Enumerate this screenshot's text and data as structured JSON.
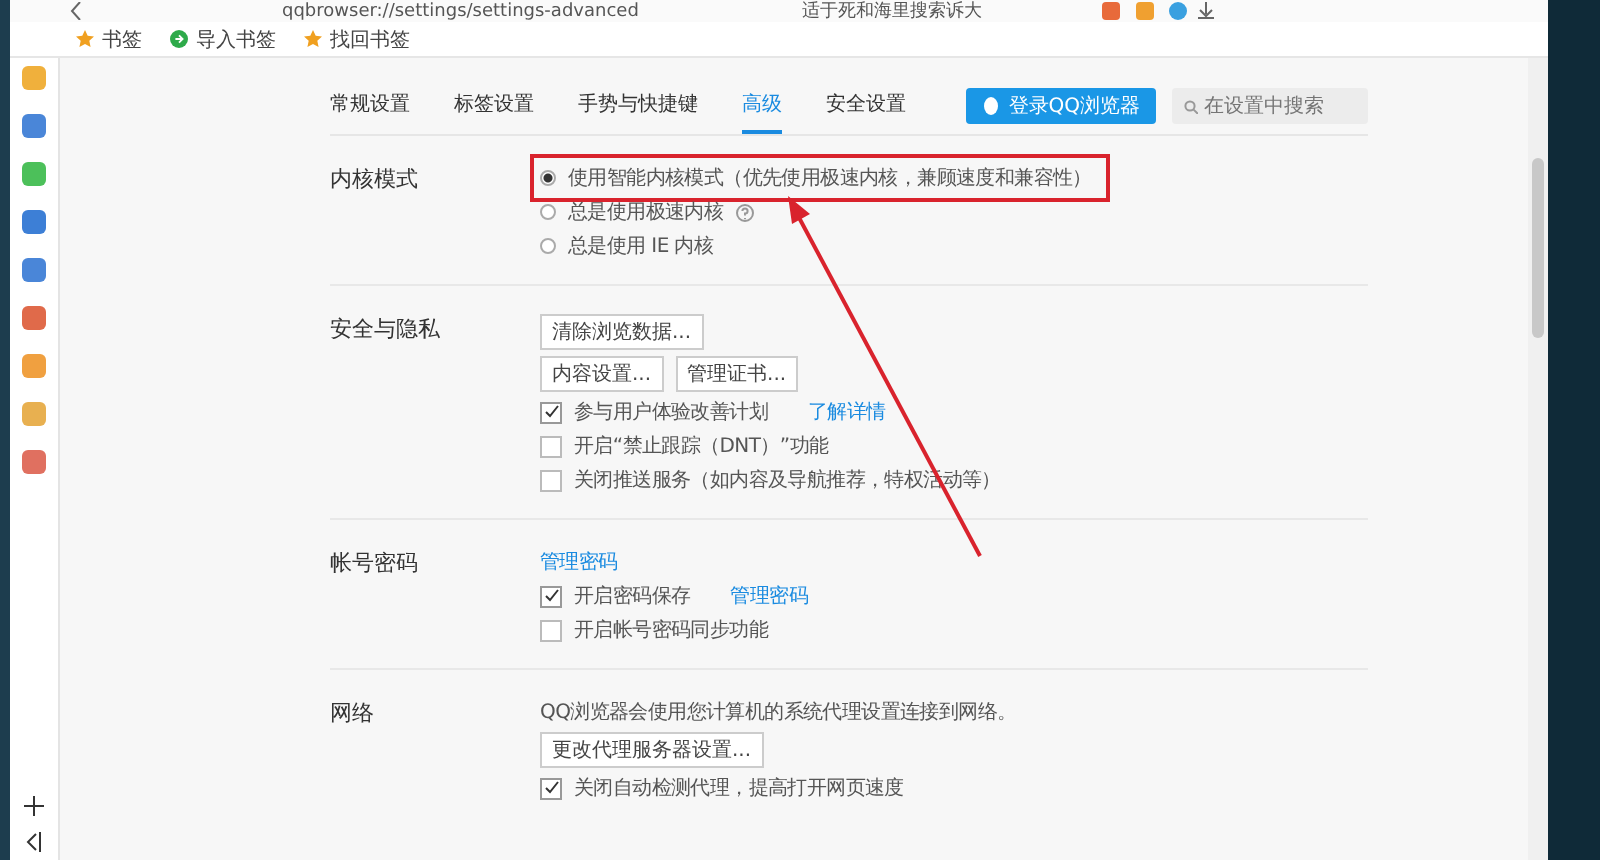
{
  "address_bar": {
    "url": "qqbrowser://settings/settings-advanced",
    "search_text": "适于死和海里搜索诉大"
  },
  "bookmarks": [
    {
      "label": "书签",
      "kind": "star"
    },
    {
      "label": "导入书签",
      "kind": "import"
    },
    {
      "label": "找回书签",
      "kind": "star"
    }
  ],
  "tabs": [
    {
      "label": "常规设置",
      "selected": false
    },
    {
      "label": "标签设置",
      "selected": false
    },
    {
      "label": "手势与快捷键",
      "selected": false
    },
    {
      "label": "高级",
      "selected": true
    },
    {
      "label": "安全设置",
      "selected": false
    }
  ],
  "login_button": "登录QQ浏览器",
  "search": {
    "placeholder": "在设置中搜索"
  },
  "sections": [
    {
      "title": "内核模式",
      "rows": [
        {
          "kind": "radio",
          "label": "使用智能内核模式（优先使用极速内核，兼顾速度和兼容性）",
          "selected": true,
          "highlighted": true
        },
        {
          "kind": "radio",
          "label": "总是使用极速内核",
          "selected": false,
          "help": true
        },
        {
          "kind": "radio",
          "label": "总是使用 IE 内核",
          "selected": false
        }
      ]
    },
    {
      "title": "安全与隐私",
      "rows": [
        {
          "kind": "buttons",
          "labels": [
            "清除浏览数据..."
          ]
        },
        {
          "kind": "buttons",
          "labels": [
            "内容设置...",
            "管理证书..."
          ]
        },
        {
          "kind": "checkbox",
          "label": "参与用户体验改善计划",
          "checked": true,
          "link": "了解详情"
        },
        {
          "kind": "checkbox",
          "label": "开启“禁止跟踪（DNT）”功能",
          "checked": false
        },
        {
          "kind": "checkbox",
          "label": "关闭推送服务（如内容及导航推荐，特权活动等）",
          "checked": false
        }
      ]
    },
    {
      "title": "帐号密码",
      "rows": [
        {
          "kind": "link",
          "label": "管理密码"
        },
        {
          "kind": "checkbox",
          "label": "开启密码保存",
          "checked": true,
          "link": "管理密码"
        },
        {
          "kind": "checkbox",
          "label": "开启帐号密码同步功能",
          "checked": false
        }
      ]
    },
    {
      "title": "网络",
      "rows": [
        {
          "kind": "text",
          "label": "QQ浏览器会使用您计算机的系统代理设置连接到网络。"
        },
        {
          "kind": "buttons",
          "labels": [
            "更改代理服务器设置..."
          ]
        },
        {
          "kind": "checkbox",
          "label": "关闭自动检测代理，提高打开网页速度",
          "checked": true
        }
      ]
    }
  ],
  "sidebar_icons": [
    {
      "color": "#f0b03c"
    },
    {
      "color": "#4a86d8"
    },
    {
      "color": "#4cc05a"
    },
    {
      "color": "#3d7fd6"
    },
    {
      "color": "#4a86d8"
    },
    {
      "color": "#e06a4a"
    },
    {
      "color": "#f0a040"
    },
    {
      "color": "#e8b050"
    },
    {
      "color": "#e07060"
    }
  ]
}
